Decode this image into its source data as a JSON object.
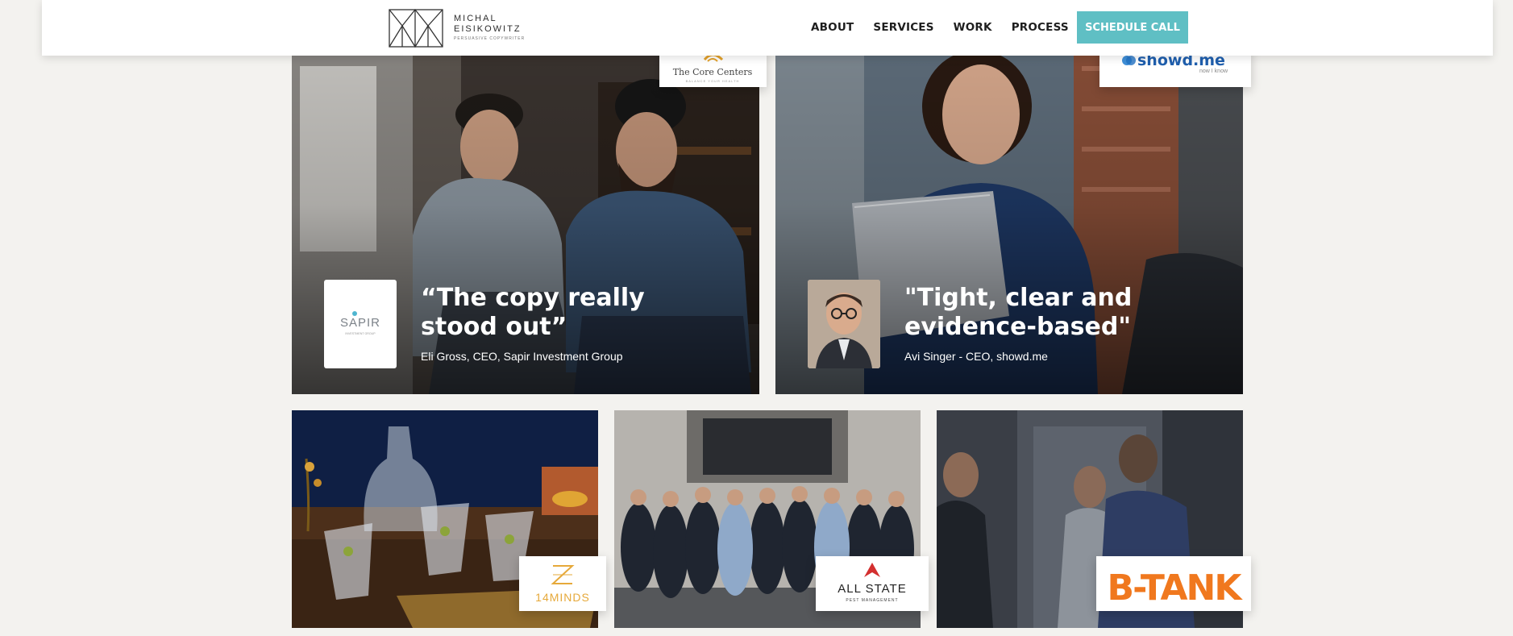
{
  "header": {
    "logo_line1": "MICHAL",
    "logo_line2": "EISIKOWITZ",
    "logo_tagline": "PERSUASIVE COPYWRITER",
    "nav": [
      "ABOUT",
      "SERVICES",
      "WORK",
      "PROCESS"
    ],
    "cta": "SCHEDULE CALL",
    "accent_color": "#5fbfc4"
  },
  "testimonials": [
    {
      "quote": "“The copy really stood out”",
      "cite": "Eli Gross, CEO, Sapir Investment Group",
      "tile_logo_text": "SAPIR",
      "tile_logo_sub": "INVESTMENT GROUP",
      "client_logo": "The Core Centers",
      "client_logo_sub": "BALANCE YOUR HEALTH"
    },
    {
      "quote": "\"Tight, clear and evidence-based\"",
      "cite": "Avi Singer - CEO, showd.me",
      "client_logo": "showd.me",
      "client_logo_sub": "now I know"
    }
  ],
  "projects": [
    {
      "logo": "14MINDS",
      "logo_color": "#e6a93a"
    },
    {
      "logo": "ALL STATE",
      "logo_sub": "PEST MANAGEMENT",
      "logo_color": "#d32f2f"
    },
    {
      "logo": "B-TANK",
      "logo_color": "#f0781e"
    }
  ]
}
